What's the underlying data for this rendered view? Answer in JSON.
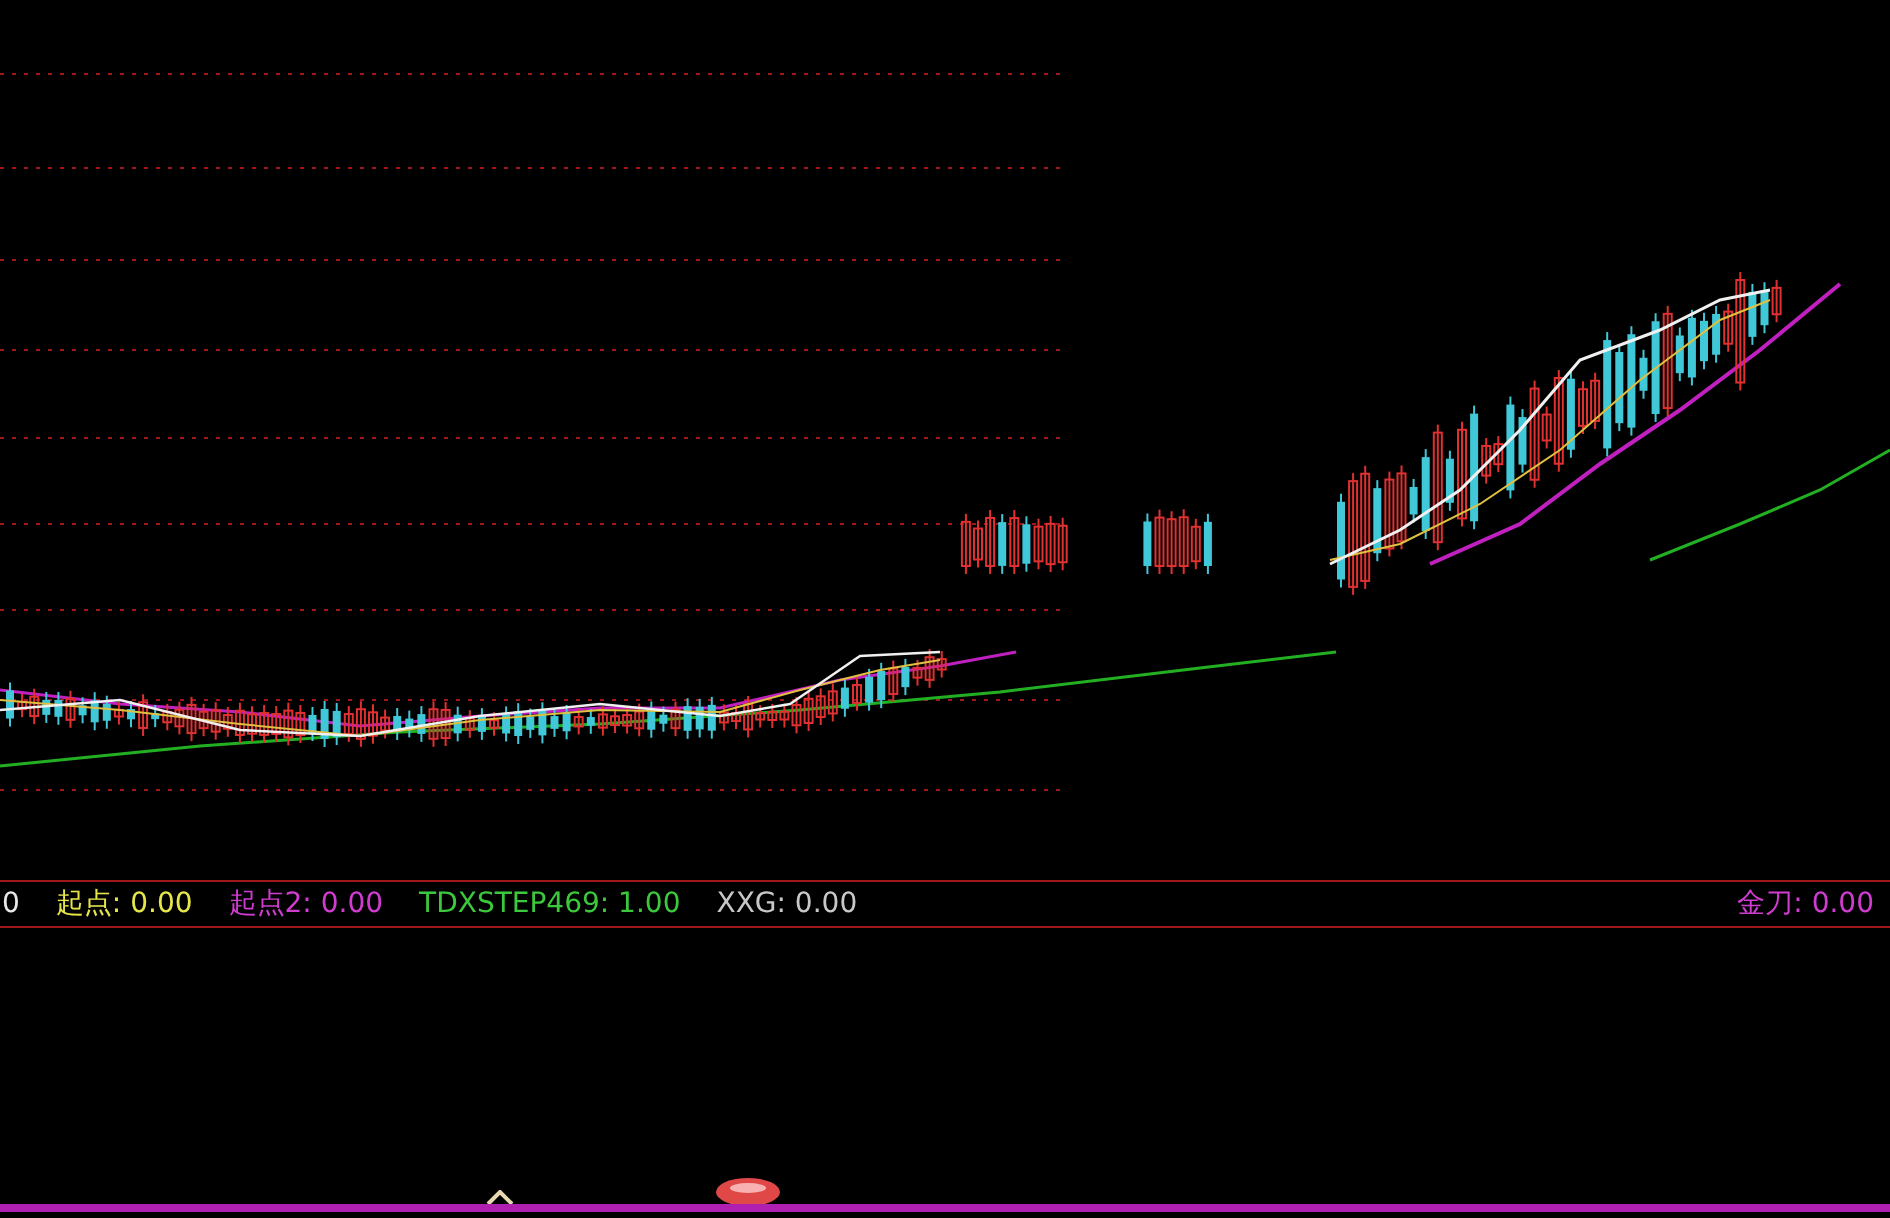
{
  "indicator_bar": [
    {
      "text": "0",
      "color": "#e8e8e8"
    },
    {
      "text": "起点: 0.00",
      "color": "#e6e64b"
    },
    {
      "text": "起点2: 0.00",
      "color": "#d03cd0"
    },
    {
      "text": "TDXSTEP469: 1.00",
      "color": "#3cc83c"
    },
    {
      "text": "XXG: 0.00",
      "color": "#c8c8c8"
    },
    {
      "text": "金刀: 0.00",
      "color": "#d03cd0"
    }
  ]
}
